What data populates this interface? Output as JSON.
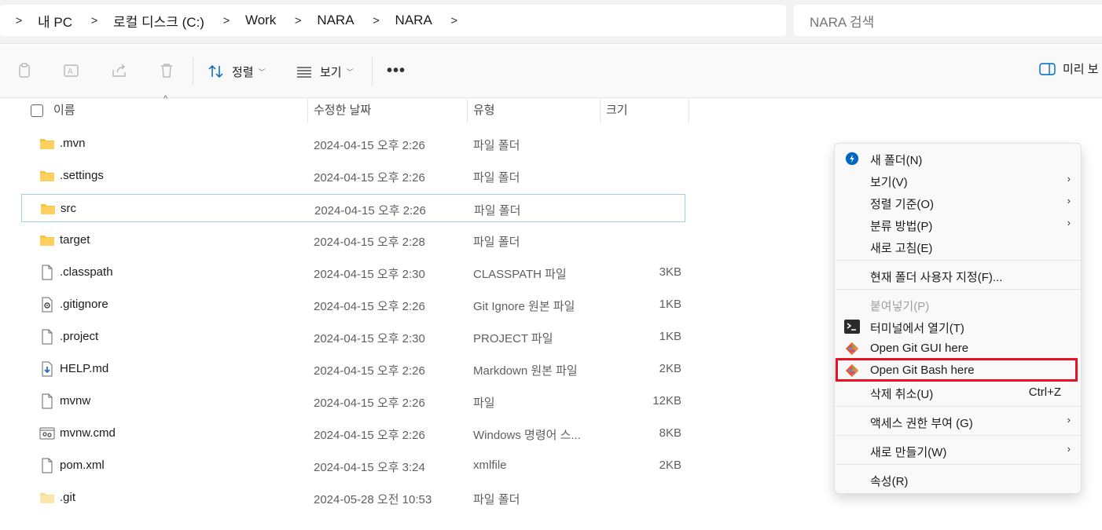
{
  "address": {
    "crumbs": [
      "내 PC",
      "로컬 디스크 (C:)",
      "Work",
      "NARA",
      "NARA"
    ]
  },
  "search": {
    "placeholder": "NARA 검색"
  },
  "toolbar": {
    "sort_label": "정렬",
    "view_label": "보기",
    "more_label": "•••",
    "preview_label": "미리 보"
  },
  "columns": {
    "name": "이름",
    "date": "수정한 날짜",
    "type": "유형",
    "size": "크기"
  },
  "files": [
    {
      "name": ".mvn",
      "date": "2024-04-15 오후 2:26",
      "type": "파일 폴더",
      "size": "",
      "icon": "folder-icon"
    },
    {
      "name": ".settings",
      "date": "2024-04-15 오후 2:26",
      "type": "파일 폴더",
      "size": "",
      "icon": "folder-icon"
    },
    {
      "name": "src",
      "date": "2024-04-15 오후 2:26",
      "type": "파일 폴더",
      "size": "",
      "icon": "folder-icon"
    },
    {
      "name": "target",
      "date": "2024-04-15 오후 2:28",
      "type": "파일 폴더",
      "size": "",
      "icon": "folder-icon"
    },
    {
      "name": ".classpath",
      "date": "2024-04-15 오후 2:30",
      "type": "CLASSPATH 파일",
      "size": "3KB",
      "icon": "file-icon"
    },
    {
      "name": ".gitignore",
      "date": "2024-04-15 오후 2:26",
      "type": "Git Ignore 원본 파일",
      "size": "1KB",
      "icon": "settings-file-icon"
    },
    {
      "name": ".project",
      "date": "2024-04-15 오후 2:30",
      "type": "PROJECT 파일",
      "size": "1KB",
      "icon": "file-icon"
    },
    {
      "name": "HELP.md",
      "date": "2024-04-15 오후 2:26",
      "type": "Markdown 원본 파일",
      "size": "2KB",
      "icon": "markdown-file-icon"
    },
    {
      "name": "mvnw",
      "date": "2024-04-15 오후 2:26",
      "type": "파일",
      "size": "12KB",
      "icon": "file-icon"
    },
    {
      "name": "mvnw.cmd",
      "date": "2024-04-15 오후 2:26",
      "type": "Windows 명령어 스...",
      "size": "8KB",
      "icon": "cmd-file-icon"
    },
    {
      "name": "pom.xml",
      "date": "2024-04-15 오후 3:24",
      "type": "xmlfile",
      "size": "2KB",
      "icon": "file-icon"
    },
    {
      "name": ".git",
      "date": "2024-05-28 오전 10:53",
      "type": "파일 폴더",
      "size": "",
      "icon": "hidden-folder-icon"
    }
  ],
  "context_menu": {
    "new_folder": "새 폴더(N)",
    "view": "보기(V)",
    "sort_by": "정렬 기준(O)",
    "group_by": "분류 방법(P)",
    "refresh": "새로 고침(E)",
    "customize": "현재 폴더 사용자 지정(F)...",
    "paste": "붙여넣기(P)",
    "open_terminal": "터미널에서 열기(T)",
    "git_gui": "Open Git GUI here",
    "git_bash": "Open Git Bash here",
    "undo_delete": "삭제 취소(U)",
    "undo_shortcut": "Ctrl+Z",
    "give_access": "액세스 권한 부여 (G)",
    "new": "새로 만들기(W)",
    "properties": "속성(R)",
    "submenu_arrow": "›"
  },
  "colors": {
    "accent": "#0067c0",
    "folder": "#f0c040",
    "highlight_box": "#e81123"
  }
}
